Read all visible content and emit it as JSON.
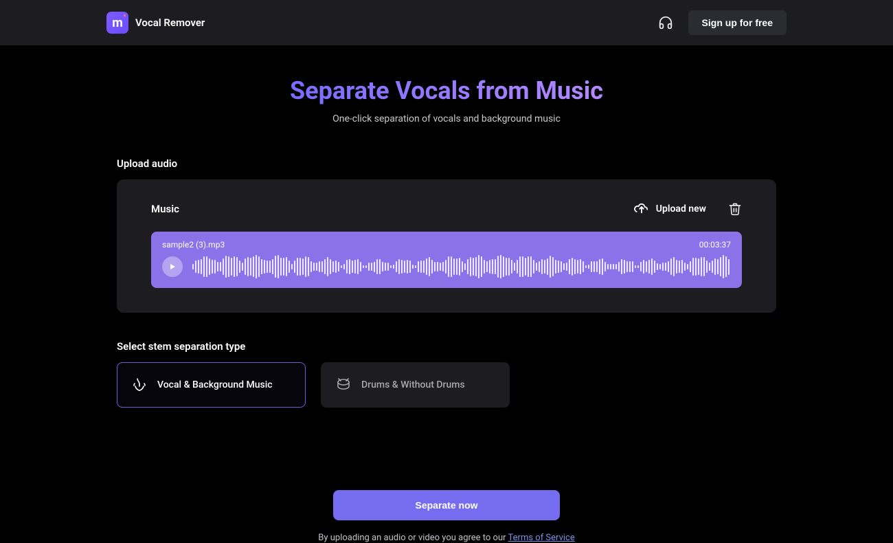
{
  "header": {
    "title": "Vocal Remover",
    "signup_label": "Sign up for free"
  },
  "hero": {
    "title": "Separate Vocals from Music",
    "subtitle": "One-click separation of vocals and background music"
  },
  "upload": {
    "section_label": "Upload audio",
    "panel_label": "Music",
    "upload_new_label": "Upload new",
    "file_name": "sample2 (3).mp3",
    "duration": "00:03:37"
  },
  "stems": {
    "section_label": "Select stem separation type",
    "options": [
      {
        "label": "Vocal & Background Music",
        "selected": true
      },
      {
        "label": "Drums & Without Drums",
        "selected": false
      }
    ]
  },
  "cta": {
    "button_label": "Separate now",
    "tos_prefix": "By uploading an audio or video you agree to our ",
    "tos_link": "Terms of Service"
  }
}
